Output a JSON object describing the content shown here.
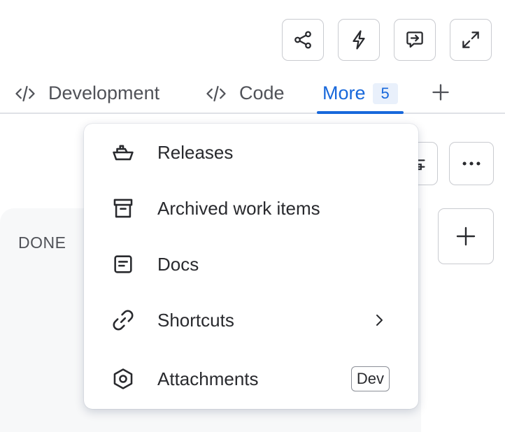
{
  "toolbar": {
    "buttons": [
      {
        "icon": "share-icon"
      },
      {
        "icon": "lightning-icon"
      },
      {
        "icon": "feedback-icon"
      },
      {
        "icon": "expand-icon"
      }
    ]
  },
  "tabs": {
    "items": [
      {
        "label": "Development",
        "icon": "code-icon"
      },
      {
        "label": "Code",
        "icon": "code-icon"
      },
      {
        "label": "More",
        "badge": "5",
        "active": true
      }
    ],
    "add_icon": "plus-icon"
  },
  "board": {
    "column_title": "DONE"
  },
  "menu": {
    "items": [
      {
        "label": "Releases",
        "icon": "ship-icon"
      },
      {
        "label": "Archived work items",
        "icon": "archive-icon"
      },
      {
        "label": "Docs",
        "icon": "document-icon"
      },
      {
        "label": "Shortcuts",
        "icon": "link-icon",
        "submenu": true
      },
      {
        "label": "Attachments",
        "icon": "hexagon-icon",
        "badge": "Dev"
      }
    ]
  },
  "colors": {
    "accent": "#1868db",
    "text": "#292a2e",
    "subtle_text": "#505258",
    "border": "#c9cbd0",
    "column_bg": "#f7f8f9"
  }
}
